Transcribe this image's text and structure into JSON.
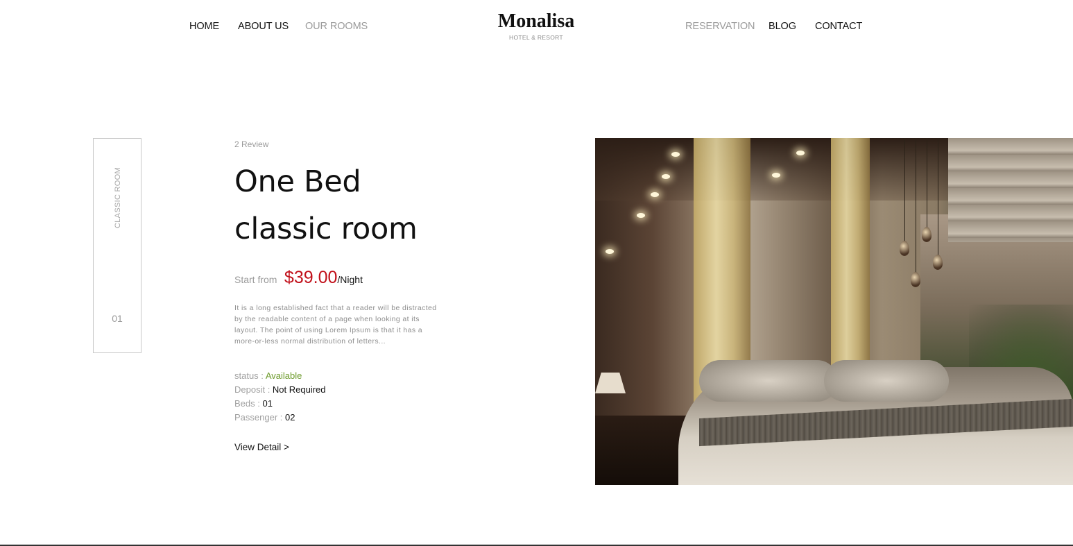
{
  "header": {
    "nav_left": [
      {
        "label": "HOME",
        "active": false
      },
      {
        "label": "ABOUT US",
        "active": false
      },
      {
        "label": "OUR ROOMS",
        "active": true
      }
    ],
    "logo": {
      "title": "Monalisa",
      "subtitle": "HOTEL & RESORT"
    },
    "nav_right": [
      {
        "label": "RESERVATION",
        "active": true
      },
      {
        "label": "BLOG",
        "active": false
      },
      {
        "label": "CONTACT",
        "active": false
      }
    ]
  },
  "side": {
    "label": "CLASSIC ROOM",
    "number": "01"
  },
  "room": {
    "reviews": "2 Review",
    "title_line1": "One Bed",
    "title_line2": "classic room",
    "price_label": "Start from",
    "price": "$39.00",
    "price_unit": "/Night",
    "description": "It is a long established fact that a reader will be distracted by the readable content of a page when looking at its layout. The point of using Lorem Ipsum is that it has a more-or-less normal distribution of letters...",
    "details": {
      "status_label": "status : ",
      "status_value": "Available",
      "deposit_label": "Deposit : ",
      "deposit_value": "Not Required",
      "beds_label": "Beds : ",
      "beds_value": "01",
      "passenger_label": "Passenger : ",
      "passenger_value": "02"
    },
    "view_detail": "View Detail >"
  },
  "colors": {
    "price": "#c1101a",
    "available": "#6c9a2a",
    "muted_nav": "#9a9a9a"
  }
}
